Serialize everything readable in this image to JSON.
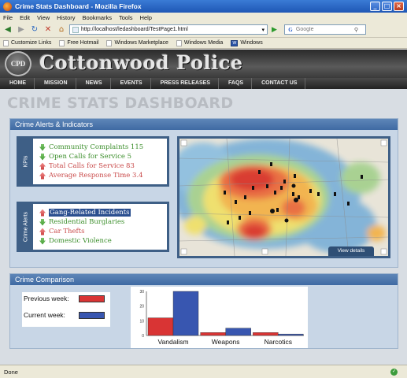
{
  "window": {
    "title": "Crime Stats Dashboard - Mozilla Firefox"
  },
  "menu": [
    "File",
    "Edit",
    "View",
    "History",
    "Bookmarks",
    "Tools",
    "Help"
  ],
  "address": {
    "url": "http://localhost/ledashboard/TestPage1.html",
    "search_placeholder": "Google"
  },
  "bookmarks": [
    "Customize Links",
    "Free Hotmail",
    "Windows Marketplace",
    "Windows Media",
    "Windows"
  ],
  "site": {
    "brand": "Cottonwood Police",
    "nav": [
      "HOME",
      "MISSION",
      "NEWS",
      "EVENTS",
      "PRESS RELEASES",
      "FAQS",
      "CONTACT US"
    ],
    "page_title": "CRIME STATS DASHBOARD"
  },
  "alerts_panel": {
    "title": "Crime Alerts & Indicators",
    "kpis_label": "KPIs",
    "kpis": [
      {
        "text": "Community Complaints 115",
        "trend": "down",
        "color": "green"
      },
      {
        "text": "Open Calls for Service 5",
        "trend": "down",
        "color": "green"
      },
      {
        "text": "Total Calls for Service 83",
        "trend": "up",
        "color": "red"
      },
      {
        "text": "Average Response Time 3.4",
        "trend": "up",
        "color": "red"
      }
    ],
    "alerts_label": "Crime Alerts",
    "alerts": [
      {
        "text": "Gang-Related Incidents",
        "trend": "up",
        "color": "selected"
      },
      {
        "text": "Residential Burglaries",
        "trend": "down",
        "color": "green"
      },
      {
        "text": "Car Thefts",
        "trend": "up",
        "color": "red"
      },
      {
        "text": "Domestic Violence",
        "trend": "down",
        "color": "green"
      }
    ],
    "map": {
      "view_details": "View details"
    }
  },
  "comparison_panel": {
    "title": "Crime Comparison",
    "legend": [
      {
        "label": "Previous week:",
        "color": "#d93434"
      },
      {
        "label": "Current week:",
        "color": "#3856b0"
      }
    ]
  },
  "chart_data": {
    "type": "bar",
    "categories": [
      "Vandalism",
      "Weapons",
      "Narcotics"
    ],
    "series": [
      {
        "name": "Previous week:",
        "values": [
          12,
          2,
          2
        ],
        "color": "#d93434"
      },
      {
        "name": "Current week:",
        "values": [
          30,
          5,
          1
        ],
        "color": "#3856b0"
      }
    ],
    "yticks": [
      0,
      10,
      20,
      30
    ],
    "ylim": [
      0,
      30
    ],
    "title": "",
    "xlabel": "",
    "ylabel": ""
  },
  "status": {
    "text": "Done"
  }
}
